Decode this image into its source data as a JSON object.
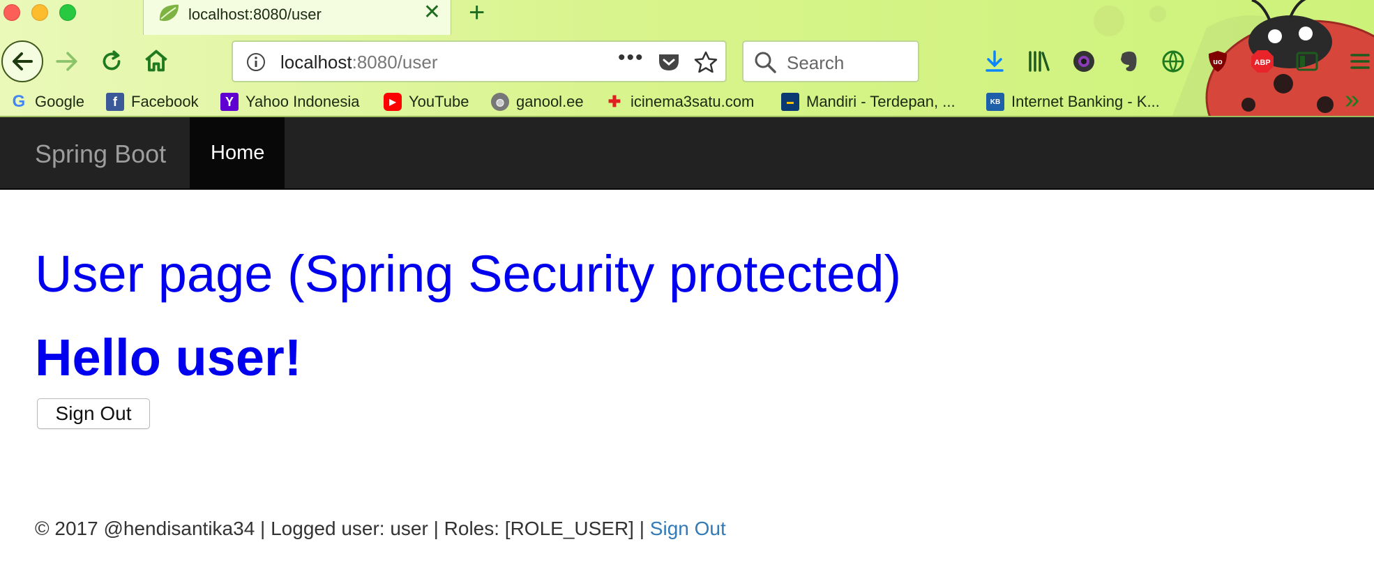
{
  "browser": {
    "tab": {
      "title": "localhost:8080/user",
      "close_glyph": "✕"
    },
    "new_tab_glyph": "+",
    "url": {
      "host": "localhost",
      "rest": ":8080/user",
      "more_glyph": "•••"
    },
    "search": {
      "placeholder": "Search"
    },
    "bookmarks": [
      {
        "label": "Google",
        "icon": "google-icon"
      },
      {
        "label": "Facebook",
        "icon": "facebook-icon"
      },
      {
        "label": "Yahoo Indonesia",
        "icon": "yahoo-icon"
      },
      {
        "label": "YouTube",
        "icon": "youtube-icon"
      },
      {
        "label": "ganool.ee",
        "icon": "globe-icon"
      },
      {
        "label": "icinema3satu.com",
        "icon": "icinema-icon"
      },
      {
        "label": "Mandiri - Terdepan, ...",
        "icon": "mandiri-icon"
      },
      {
        "label": "Internet Banking - K...",
        "icon": "bank-icon"
      }
    ],
    "overflow_glyph": "»"
  },
  "site": {
    "brand": "Spring Boot",
    "nav": {
      "home": "Home"
    },
    "heading": "User page (Spring Security protected)",
    "greeting": "Hello user!",
    "sign_out_button": "Sign Out",
    "footer": {
      "text": "© 2017 @hendisantika34 | Logged user: user | Roles: [ROLE_USER] | ",
      "link": "Sign Out"
    }
  },
  "colors": {
    "heading": "#0000ee",
    "navbar": "#222222",
    "link": "#337ab7",
    "chrome": "#d8f48c"
  }
}
